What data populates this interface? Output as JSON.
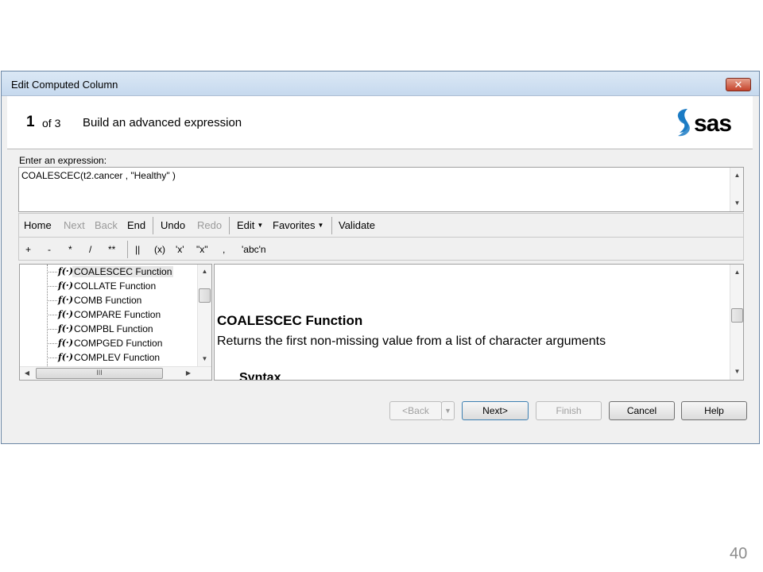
{
  "window": {
    "title": "Edit Computed Column",
    "close_label": "✕"
  },
  "header": {
    "step_number": "1",
    "step_of": "of 3",
    "step_description": "Build an advanced expression",
    "brand_logo_text": "sas",
    "brand_color": "#1b7bc4"
  },
  "expression": {
    "label": "Enter an expression:",
    "value": "COALESCEC(t2.cancer , \"Healthy\" )"
  },
  "toolbar": {
    "home": "Home",
    "next": "Next",
    "back": "Back",
    "end": "End",
    "undo": "Undo",
    "redo": "Redo",
    "edit": "Edit",
    "favorites": "Favorites",
    "validate": "Validate"
  },
  "operators": [
    "+",
    "-",
    "*",
    "/",
    "**",
    "||",
    "(x)",
    "'x'",
    "\"x\"",
    ",",
    "'abc'n"
  ],
  "function_tree": {
    "icon": "function-icon",
    "items": [
      "COALESCEC Function",
      "COLLATE Function",
      "COMB Function",
      "COMPARE Function",
      "COMPBL Function",
      "COMPGED Function",
      "COMPLEV Function"
    ],
    "selected": "COALESCEC Function"
  },
  "help": {
    "title": "COALESCEC Function",
    "description": "Returns the first non-missing value from a list of character arguments",
    "syntax_heading": "Syntax"
  },
  "buttons": {
    "back": "<Back",
    "next": "Next>",
    "finish": "Finish",
    "cancel": "Cancel",
    "help": "Help"
  },
  "slide": {
    "page_number": "40"
  }
}
